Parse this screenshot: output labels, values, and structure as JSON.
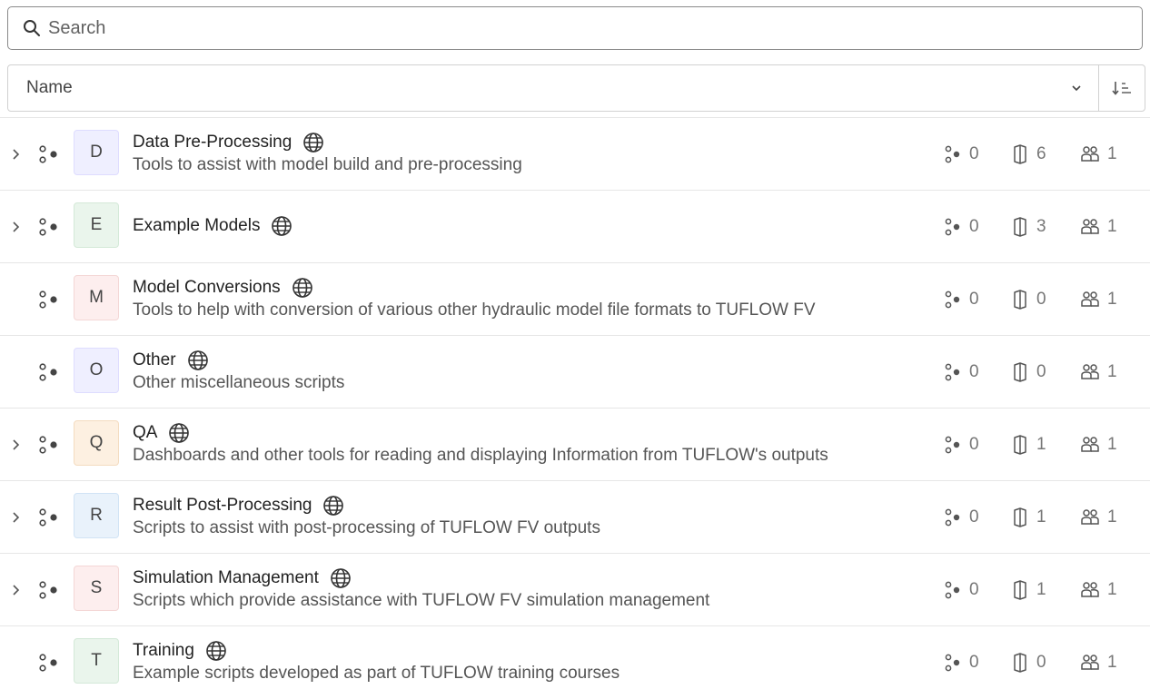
{
  "search": {
    "placeholder": "Search"
  },
  "sort": {
    "field": "Name"
  },
  "colors": {
    "D": {
      "bg": "#efefff",
      "border": "#dedcff"
    },
    "E": {
      "bg": "#eaf5ec",
      "border": "#d4e9d8"
    },
    "M": {
      "bg": "#fdeeee",
      "border": "#f4d7d6"
    },
    "O": {
      "bg": "#efefff",
      "border": "#dedcff"
    },
    "Q": {
      "bg": "#fdf0e1",
      "border": "#f4dcc0"
    },
    "R": {
      "bg": "#e9f2fb",
      "border": "#d1e3f5"
    },
    "S": {
      "bg": "#fdeeee",
      "border": "#f4d7d6"
    },
    "T": {
      "bg": "#eaf5ec",
      "border": "#d4e9d8"
    }
  },
  "items": [
    {
      "letter": "D",
      "title": "Data Pre-Processing",
      "desc": "Tools to assist with model build and pre-processing",
      "expandable": true,
      "projects": "0",
      "scripts": "6",
      "members": "1"
    },
    {
      "letter": "E",
      "title": "Example Models",
      "desc": "",
      "expandable": true,
      "projects": "0",
      "scripts": "3",
      "members": "1"
    },
    {
      "letter": "M",
      "title": "Model Conversions",
      "desc": "Tools to help with conversion of various other hydraulic model file formats to TUFLOW FV",
      "expandable": false,
      "projects": "0",
      "scripts": "0",
      "members": "1"
    },
    {
      "letter": "O",
      "title": "Other",
      "desc": "Other miscellaneous scripts",
      "expandable": false,
      "projects": "0",
      "scripts": "0",
      "members": "1"
    },
    {
      "letter": "Q",
      "title": "QA",
      "desc": "Dashboards and other tools for reading and displaying Information from TUFLOW's outputs",
      "expandable": true,
      "projects": "0",
      "scripts": "1",
      "members": "1"
    },
    {
      "letter": "R",
      "title": "Result Post-Processing",
      "desc": "Scripts to assist with post-processing of TUFLOW FV outputs",
      "expandable": true,
      "projects": "0",
      "scripts": "1",
      "members": "1"
    },
    {
      "letter": "S",
      "title": "Simulation Management",
      "desc": "Scripts which provide assistance with TUFLOW FV simulation management",
      "expandable": true,
      "projects": "0",
      "scripts": "1",
      "members": "1"
    },
    {
      "letter": "T",
      "title": "Training",
      "desc": "Example scripts developed as part of TUFLOW training courses",
      "expandable": false,
      "projects": "0",
      "scripts": "0",
      "members": "1"
    }
  ]
}
